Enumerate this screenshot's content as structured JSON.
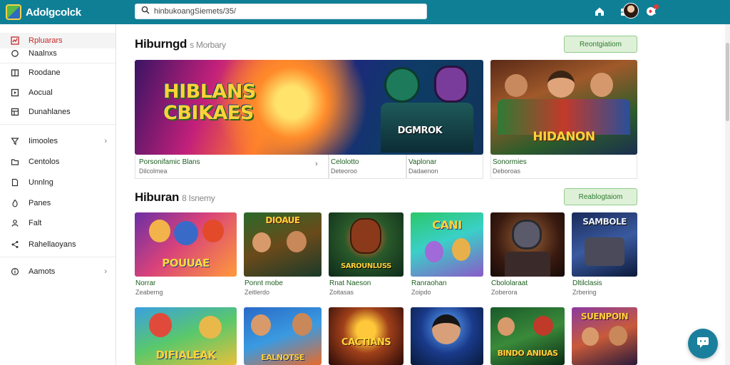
{
  "app": {
    "title": "Adolgcolck",
    "search_value": "hinbukoangSiemets/35/"
  },
  "sidebar": {
    "items": [
      {
        "label": "Rpluarars",
        "icon": "trending-icon",
        "active": true
      },
      {
        "label": "Naalnxs",
        "icon": "circle-icon"
      },
      {
        "label": "Roodane",
        "icon": "library-icon"
      },
      {
        "label": "Aocual",
        "icon": "square-play-icon"
      },
      {
        "label": "Dunahlanes",
        "icon": "grid-icon"
      },
      {
        "label": "Iimooles",
        "icon": "filter-icon",
        "chevron": true
      },
      {
        "label": "Centolos",
        "icon": "folder-icon"
      },
      {
        "label": "Unnlng",
        "icon": "document-icon"
      },
      {
        "label": "Panes",
        "icon": "flame-icon"
      },
      {
        "label": "Falt",
        "icon": "person-icon"
      },
      {
        "label": "Rahellaoyans",
        "icon": "share-icon"
      },
      {
        "label": "Aamots",
        "icon": "info-icon",
        "chevron": true
      }
    ]
  },
  "sections": [
    {
      "title": "Hiburngd",
      "subtitle": "s Morbary",
      "button": "Reontgiatiom"
    },
    {
      "title": "Hiburan",
      "subtitle": "8 Isnemy",
      "button": "Reablogtaiom"
    }
  ],
  "featured": [
    {
      "thumb_title": "HIBLANS CBIKAES",
      "sub_title": "DGMROK",
      "name": "Porsonifamic Blans",
      "meta": "Dilcolmea"
    },
    {
      "name": "Celolotto",
      "meta": "Deteoroo"
    },
    {
      "name": "Vaplonar",
      "meta": "Dadaenon"
    },
    {
      "thumb_title": "HIDANON",
      "name": "Sonormies",
      "meta": "Deboroas"
    }
  ],
  "grid_row1": [
    {
      "thumb_title": "POUUAE",
      "name": "Norrar",
      "meta": "Zeaberng"
    },
    {
      "thumb_title": "DIOAUE",
      "name": "Ponnt mobe",
      "meta": "Zeitlerdo"
    },
    {
      "thumb_title": "SAROUNLUSS",
      "name": "Rnat Naeson",
      "meta": "Zoitasas"
    },
    {
      "thumb_title": "CANI",
      "name": "Ranraohan",
      "meta": "Zoipdo"
    },
    {
      "thumb_title": "",
      "name": "Cbololaraat",
      "meta": "Zoberora"
    },
    {
      "thumb_title": "SAMBOLE",
      "name": "Dltilclasis",
      "meta": "Zrbering"
    }
  ],
  "grid_row2": [
    {
      "thumb_title": "DIFIALEAK"
    },
    {
      "thumb_title": "EALNOTSE"
    },
    {
      "thumb_title": "CACTIANS"
    },
    {
      "thumb_title": ""
    },
    {
      "thumb_title": "BINDO ANIUAS"
    },
    {
      "thumb_title": "SUENPOIN"
    }
  ],
  "colors": {
    "topbar": "#0f7f96",
    "accent_green": "#2e7d32",
    "active_item": "#c62828"
  }
}
